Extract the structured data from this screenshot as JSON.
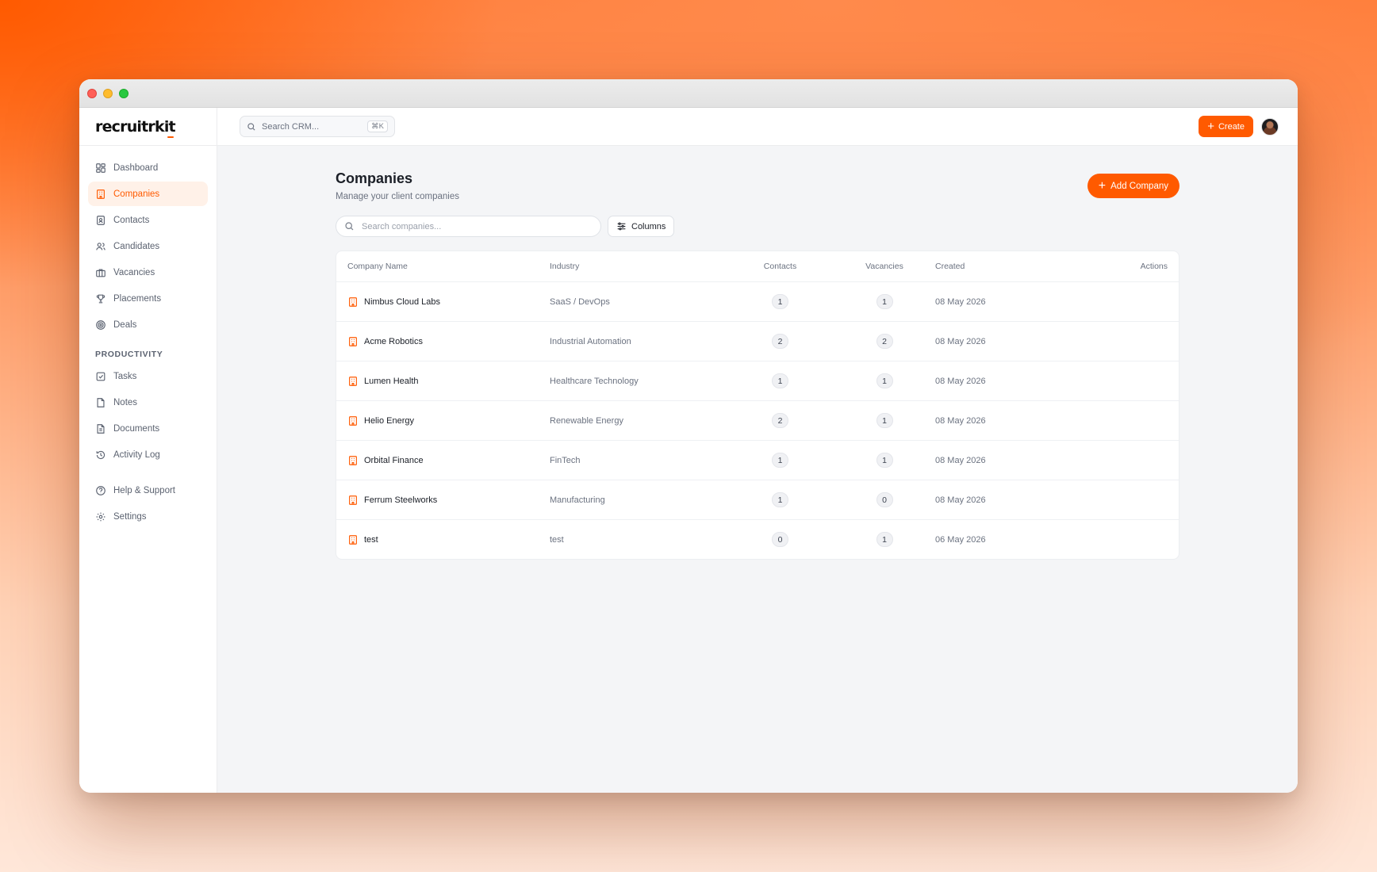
{
  "app": {
    "logo": "recruitrkit"
  },
  "sidebar": {
    "items": [
      {
        "label": "Dashboard",
        "icon": "dashboard-icon",
        "active": false
      },
      {
        "label": "Companies",
        "icon": "building-icon",
        "active": true
      },
      {
        "label": "Contacts",
        "icon": "contact-card-icon",
        "active": false
      },
      {
        "label": "Candidates",
        "icon": "users-icon",
        "active": false
      },
      {
        "label": "Vacancies",
        "icon": "briefcase-icon",
        "active": false
      },
      {
        "label": "Placements",
        "icon": "trophy-icon",
        "active": false
      },
      {
        "label": "Deals",
        "icon": "target-icon",
        "active": false
      }
    ],
    "productivity_label": "PRODUCTIVITY",
    "productivity_items": [
      {
        "label": "Tasks",
        "icon": "checkbox-icon"
      },
      {
        "label": "Notes",
        "icon": "note-icon"
      },
      {
        "label": "Documents",
        "icon": "document-icon"
      },
      {
        "label": "Activity Log",
        "icon": "history-icon"
      }
    ],
    "footer_items": [
      {
        "label": "Help & Support",
        "icon": "help-icon"
      },
      {
        "label": "Settings",
        "icon": "gear-icon"
      }
    ]
  },
  "topbar": {
    "search_placeholder": "Search CRM...",
    "shortcut": "⌘K",
    "create_label": "Create"
  },
  "page": {
    "title": "Companies",
    "subtitle": "Manage your client companies",
    "add_button": "Add Company",
    "search_placeholder": "Search companies...",
    "columns_button": "Columns"
  },
  "table": {
    "headers": {
      "name": "Company Name",
      "industry": "Industry",
      "contacts": "Contacts",
      "vacancies": "Vacancies",
      "created": "Created",
      "actions": "Actions"
    },
    "rows": [
      {
        "name": "Nimbus Cloud Labs",
        "industry": "SaaS / DevOps",
        "contacts": "1",
        "vacancies": "1",
        "created": "08 May 2026"
      },
      {
        "name": "Acme Robotics",
        "industry": "Industrial Automation",
        "contacts": "2",
        "vacancies": "2",
        "created": "08 May 2026"
      },
      {
        "name": "Lumen Health",
        "industry": "Healthcare Technology",
        "contacts": "1",
        "vacancies": "1",
        "created": "08 May 2026"
      },
      {
        "name": "Helio Energy",
        "industry": "Renewable Energy",
        "contacts": "2",
        "vacancies": "1",
        "created": "08 May 2026"
      },
      {
        "name": "Orbital Finance",
        "industry": "FinTech",
        "contacts": "1",
        "vacancies": "1",
        "created": "08 May 2026"
      },
      {
        "name": "Ferrum Steelworks",
        "industry": "Manufacturing",
        "contacts": "1",
        "vacancies": "0",
        "created": "08 May 2026"
      },
      {
        "name": "test",
        "industry": "test",
        "contacts": "0",
        "vacancies": "1",
        "created": "06 May 2026"
      }
    ]
  },
  "colors": {
    "accent": "#ff5a00",
    "active_bg": "#fff1e8"
  }
}
